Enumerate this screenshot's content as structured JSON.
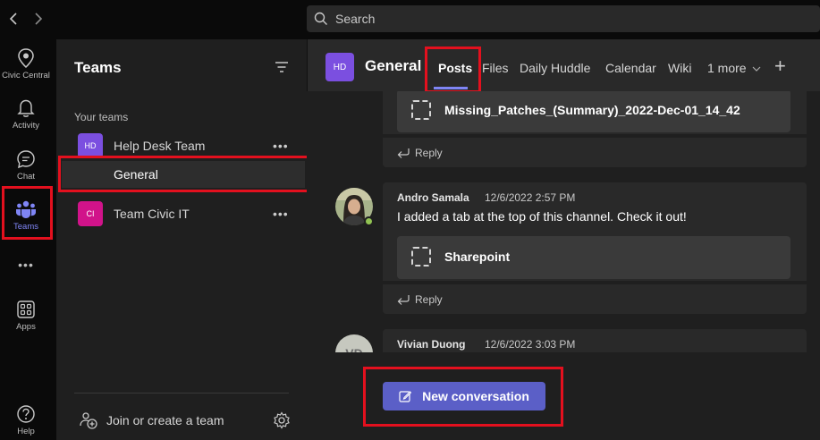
{
  "search": {
    "label": "Search"
  },
  "appbar": {
    "items": [
      {
        "label": "Civic Central",
        "icon": "location-pin-icon"
      },
      {
        "label": "Activity",
        "icon": "bell-icon"
      },
      {
        "label": "Chat",
        "icon": "chat-icon"
      },
      {
        "label": "Teams",
        "icon": "people-icon"
      },
      {
        "label": "Apps",
        "icon": "apps-icon"
      },
      {
        "label": "Help",
        "icon": "help-icon"
      }
    ],
    "more": "•••"
  },
  "teams_panel": {
    "title": "Teams",
    "section_label": "Your teams",
    "teams": [
      {
        "initials": "HD",
        "name": "Help Desk Team",
        "color": "#7b4fe0",
        "more": "•••"
      },
      {
        "initials": "CI",
        "name": "Team Civic IT",
        "color": "#d1138a",
        "more": "•••"
      }
    ],
    "channel": "General",
    "join_label": "Join or create a team"
  },
  "channel_header": {
    "avatar": "HD",
    "title": "General",
    "tabs": [
      "Posts",
      "Files",
      "Daily Huddle",
      "Calendar",
      "Wiki",
      "1 more"
    ],
    "add": "+"
  },
  "posts": {
    "attachment_top": "Missing_Patches_(Summary)_2022-Dec-01_14_42",
    "reply": "Reply",
    "post2": {
      "author": "Andro Samala",
      "time": "12/6/2022 2:57 PM",
      "message": "I added a tab at the top of this channel. Check it out!",
      "attachment": "Sharepoint"
    },
    "post3": {
      "author": "Vivian Duong",
      "time": "12/6/2022 3:03 PM",
      "initials": "VD"
    }
  },
  "composer": {
    "new_conversation": "New conversation"
  },
  "colors": {
    "accent": "#5b5fc7",
    "highlight": "#e3101e",
    "presence": "#92c353"
  }
}
